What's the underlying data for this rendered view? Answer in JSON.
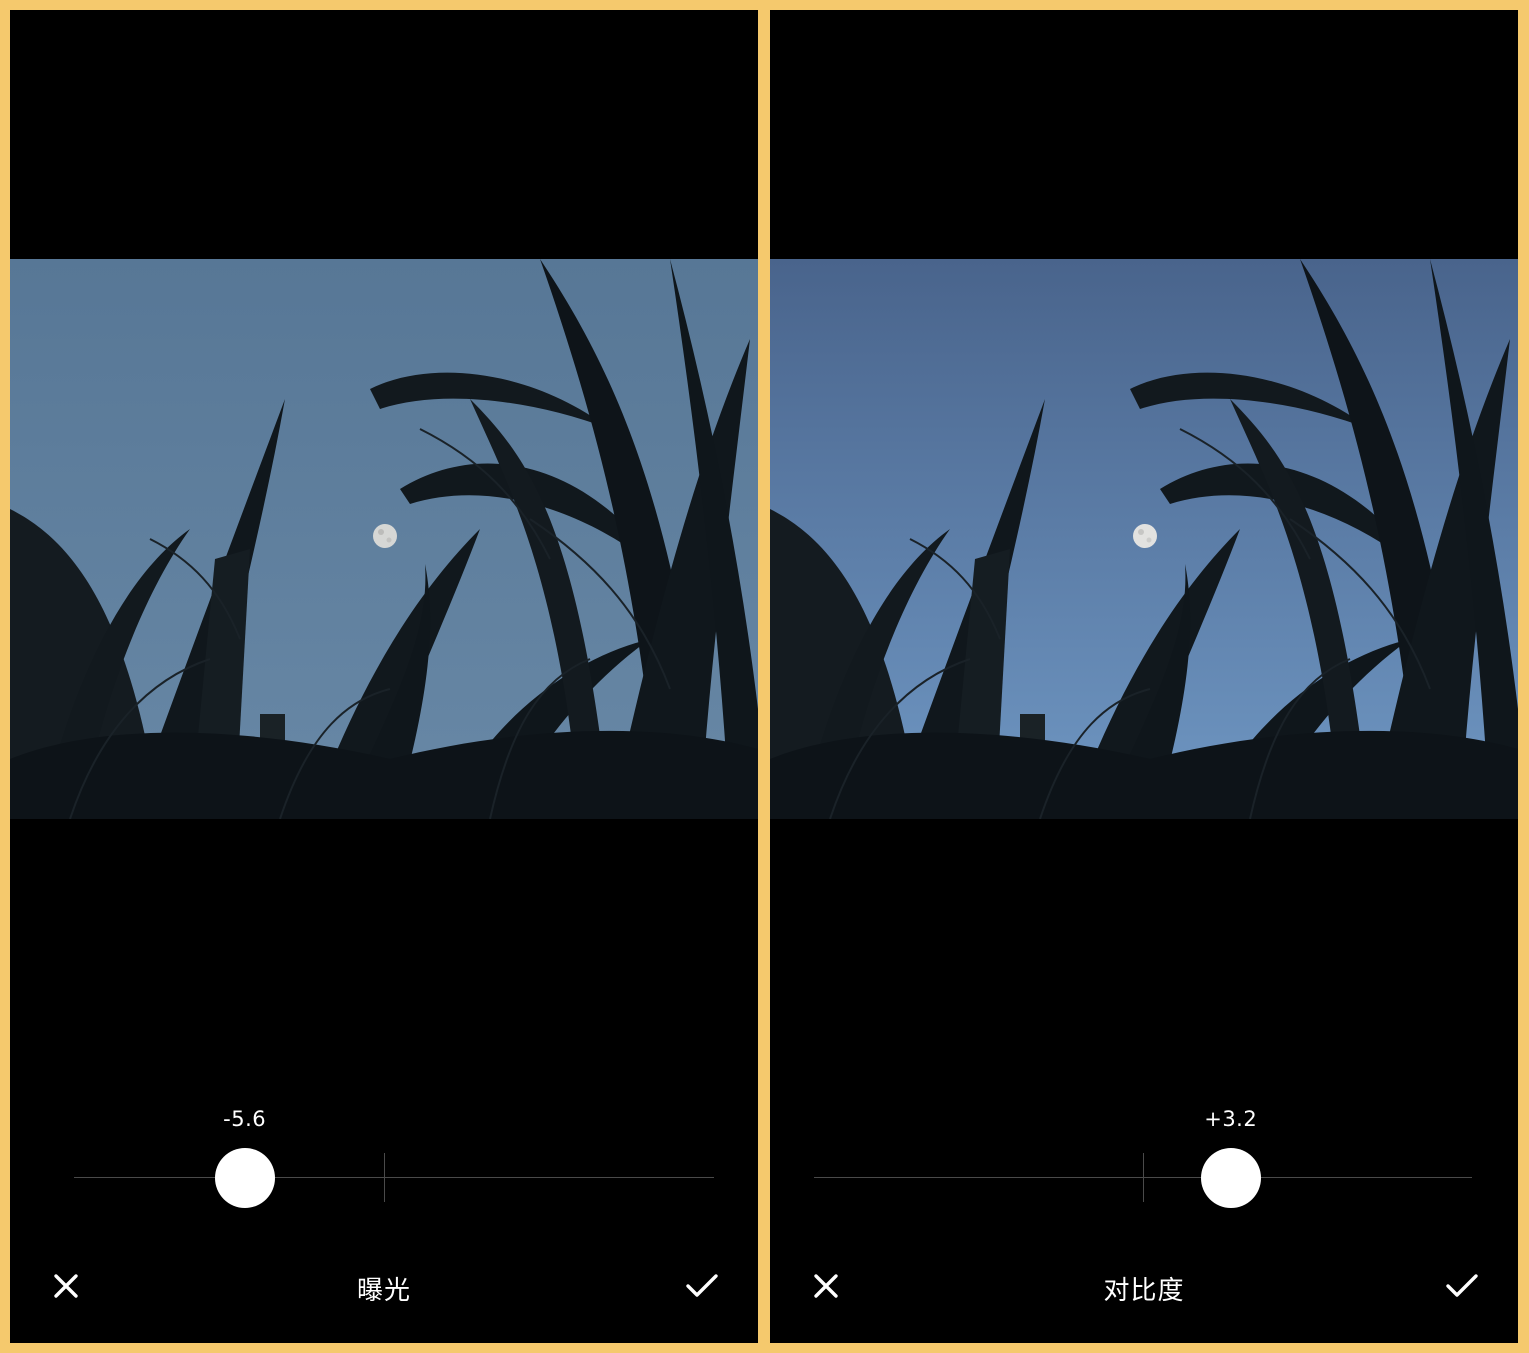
{
  "frame": {
    "background": "#f5c96d"
  },
  "panels": [
    {
      "tool_name": "曝光",
      "slider": {
        "value_text": "-5.6",
        "value": -5.6,
        "min": -12,
        "max": 12
      },
      "photo": {
        "sky_top": "#577796",
        "sky_bottom": "#6888a6"
      },
      "icons": {
        "cancel": "close-icon",
        "confirm": "checkmark-icon"
      }
    },
    {
      "tool_name": "对比度",
      "slider": {
        "value_text": "+3.2",
        "value": 3.2,
        "min": -12,
        "max": 12
      },
      "photo": {
        "sky_top": "#49648c",
        "sky_bottom": "#6f97c3"
      },
      "icons": {
        "cancel": "close-icon",
        "confirm": "checkmark-icon"
      }
    }
  ]
}
